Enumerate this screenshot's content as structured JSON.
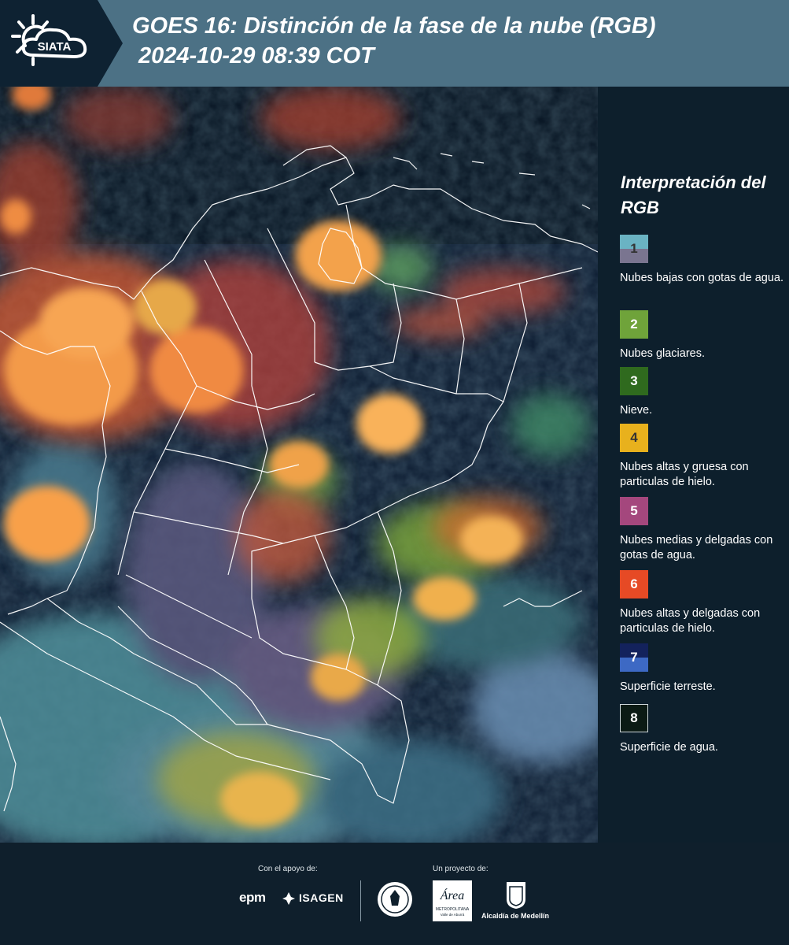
{
  "header": {
    "brand": "SIATA",
    "title_line1": "GOES 16: Distinción de la fase de la nube (RGB)",
    "title_line2": "2024-10-29 08:39 COT",
    "icons": [
      "sun-icon",
      "cloud-icon"
    ]
  },
  "legend": {
    "title": "Interpretación del RGB",
    "items": [
      {
        "num": "1",
        "label": "Nubes bajas con gotas de agua.",
        "color_top": "#6ab3c3",
        "color_bottom": "#7a7590"
      },
      {
        "num": "2",
        "label": "Nubes glaciares.",
        "color": "#6fa33a"
      },
      {
        "num": "3",
        "label": "Nieve.",
        "color": "#2f6a1e"
      },
      {
        "num": "4",
        "label": "Nubes altas y gruesa con particulas de hielo.",
        "color": "#e8b11d"
      },
      {
        "num": "5",
        "label": "Nubes medias y delgadas con gotas de agua.",
        "color": "#a4477d"
      },
      {
        "num": "6",
        "label": "Nubes altas y delgadas con particulas de hielo.",
        "color": "#e64a25"
      },
      {
        "num": "7",
        "label": "Superficie terreste.",
        "color_top": "#13225c",
        "color_bottom": "#3d69c4"
      },
      {
        "num": "8",
        "label": "Superficie de agua.",
        "color": "#0b1a14"
      }
    ]
  },
  "footer": {
    "support_label": "Con el apoyo de:",
    "project_label": "Un proyecto de:",
    "sponsor_epm": "epm",
    "sponsor_isagen": "ISAGEN",
    "partner_area_metropolitana": "Área",
    "partner_area_sub": "METROPOLITANA",
    "partner_area_sub2": "Valle de Aburrá",
    "partner_medellin": "Alcaldía de Medellín",
    "icons": [
      "university-seal-icon",
      "area-metropolitana-logo-icon",
      "medellin-shield-icon"
    ]
  },
  "colors": {
    "header_bg": "#4c7185",
    "panel_bg": "#0d1f2c",
    "deep_convection": "#f5a84a",
    "thin_ice": "#e0603a"
  }
}
